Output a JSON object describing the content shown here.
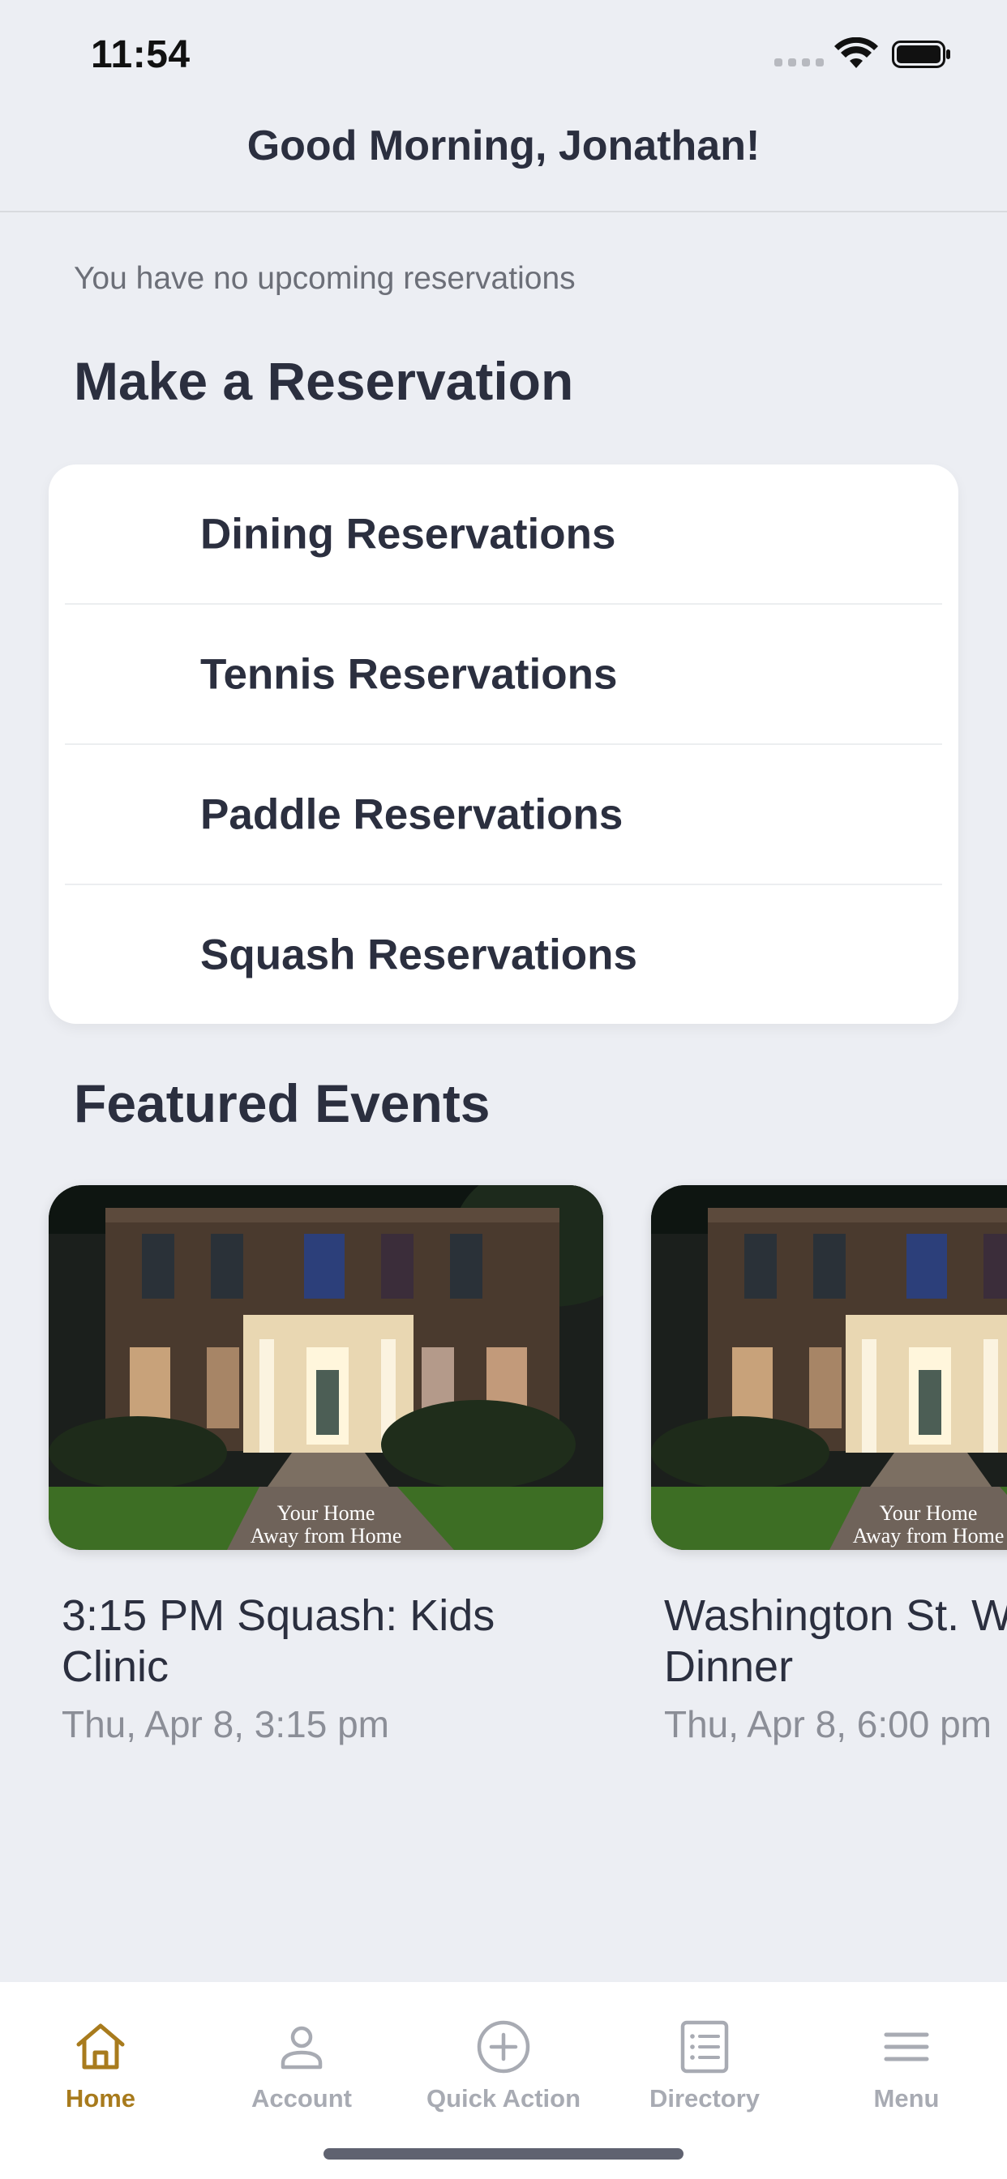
{
  "status_bar": {
    "time": "11:54"
  },
  "header": {
    "greeting": "Good Morning, Jonathan!"
  },
  "reservations": {
    "empty_message": "You have no upcoming reservations",
    "section_title": "Make a Reservation",
    "items": [
      {
        "label": "Dining Reservations"
      },
      {
        "label": "Tennis Reservations"
      },
      {
        "label": "Paddle Reservations"
      },
      {
        "label": "Squash Reservations"
      }
    ]
  },
  "events": {
    "section_title": "Featured Events",
    "image_caption_line1": "Your Home",
    "image_caption_line2": "Away from Home",
    "items": [
      {
        "title_line1": "3:15 PM Squash: Kids",
        "title_line2": "Clinic",
        "date": "Thu, Apr 8, 3:15 pm"
      },
      {
        "title_line1": "Washington St. W",
        "title_line2": "Dinner",
        "date": "Thu, Apr 8, 6:00 pm"
      }
    ]
  },
  "tab_bar": {
    "active_color": "#a87b1d",
    "inactive_color": "#a8abb3",
    "tabs": [
      {
        "label": "Home",
        "icon": "home-icon",
        "active": true
      },
      {
        "label": "Account",
        "icon": "person-icon",
        "active": false
      },
      {
        "label": "Quick Action",
        "icon": "plus-circle-icon",
        "active": false
      },
      {
        "label": "Directory",
        "icon": "list-document-icon",
        "active": false
      },
      {
        "label": "Menu",
        "icon": "hamburger-menu-icon",
        "active": false
      }
    ]
  }
}
